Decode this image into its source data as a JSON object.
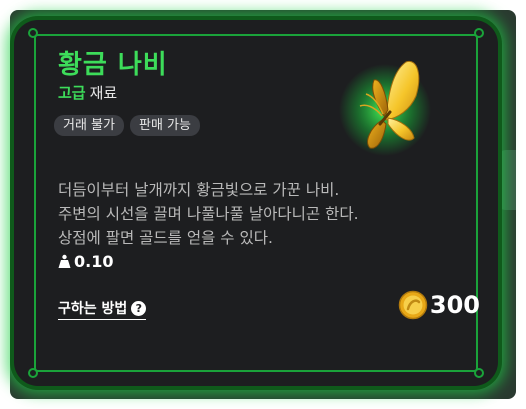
{
  "item": {
    "name": "황금 나비",
    "grade": "고급",
    "category": "재료",
    "tags": [
      "거래 불가",
      "판매 가능"
    ],
    "description": [
      "더듬이부터 날개까지 황금빛으로 가꾼 나비.",
      "주변의 시선을 끌며 나풀나풀 날아다니곤 한다.",
      "상점에 팔면 골드를 얻을 수 있다."
    ],
    "weight": "0.10",
    "price": "300"
  },
  "actions": {
    "how_to_obtain_label": "구하는 방법"
  },
  "icons": {
    "item": "golden-butterfly-icon",
    "weight": "weight-icon",
    "help": "question-circle-icon",
    "currency": "gold-coin-icon"
  },
  "colors": {
    "accent_green": "#3ddc5a",
    "frame_green": "#1aa33a",
    "glow_green": "#1ed246",
    "card_bg": "#1d1e20",
    "tag_bg": "#3b3d42",
    "gold": "#f5b820"
  }
}
